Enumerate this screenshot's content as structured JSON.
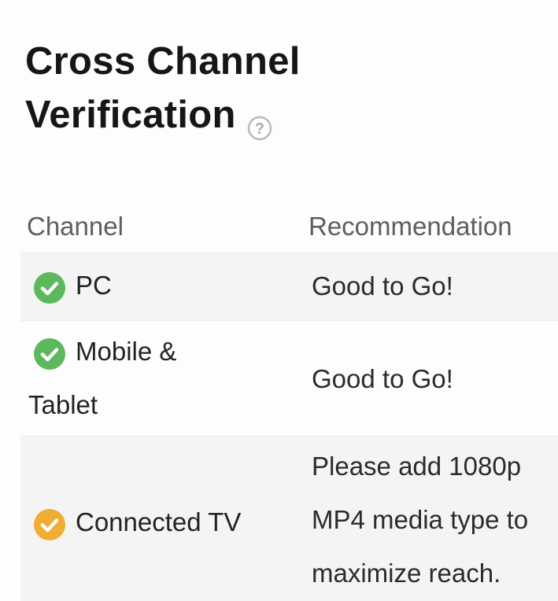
{
  "title": {
    "line1": "Cross Channel",
    "line2": "Verification"
  },
  "table": {
    "headers": {
      "channel": "Channel",
      "recommendation": "Recommendation"
    },
    "rows": [
      {
        "channel_line1": "PC",
        "status": "ok",
        "recommendation": "Good to Go!"
      },
      {
        "channel_line1": "Mobile &",
        "channel_line2": "Tablet",
        "status": "ok",
        "recommendation": "Good to Go!"
      },
      {
        "channel_line1": "Connected TV",
        "status": "warning",
        "recommendation_lines": [
          "Please add 1080p",
          "MP4 media type to",
          "maximize reach."
        ]
      }
    ]
  },
  "icons": {
    "help": "question-circle-icon",
    "ok": "check-circle-icon",
    "warning": "check-circle-warning-icon"
  },
  "colors": {
    "ok": "#5cb85c",
    "warning": "#f0ad33",
    "help": "#b9b9b9"
  }
}
